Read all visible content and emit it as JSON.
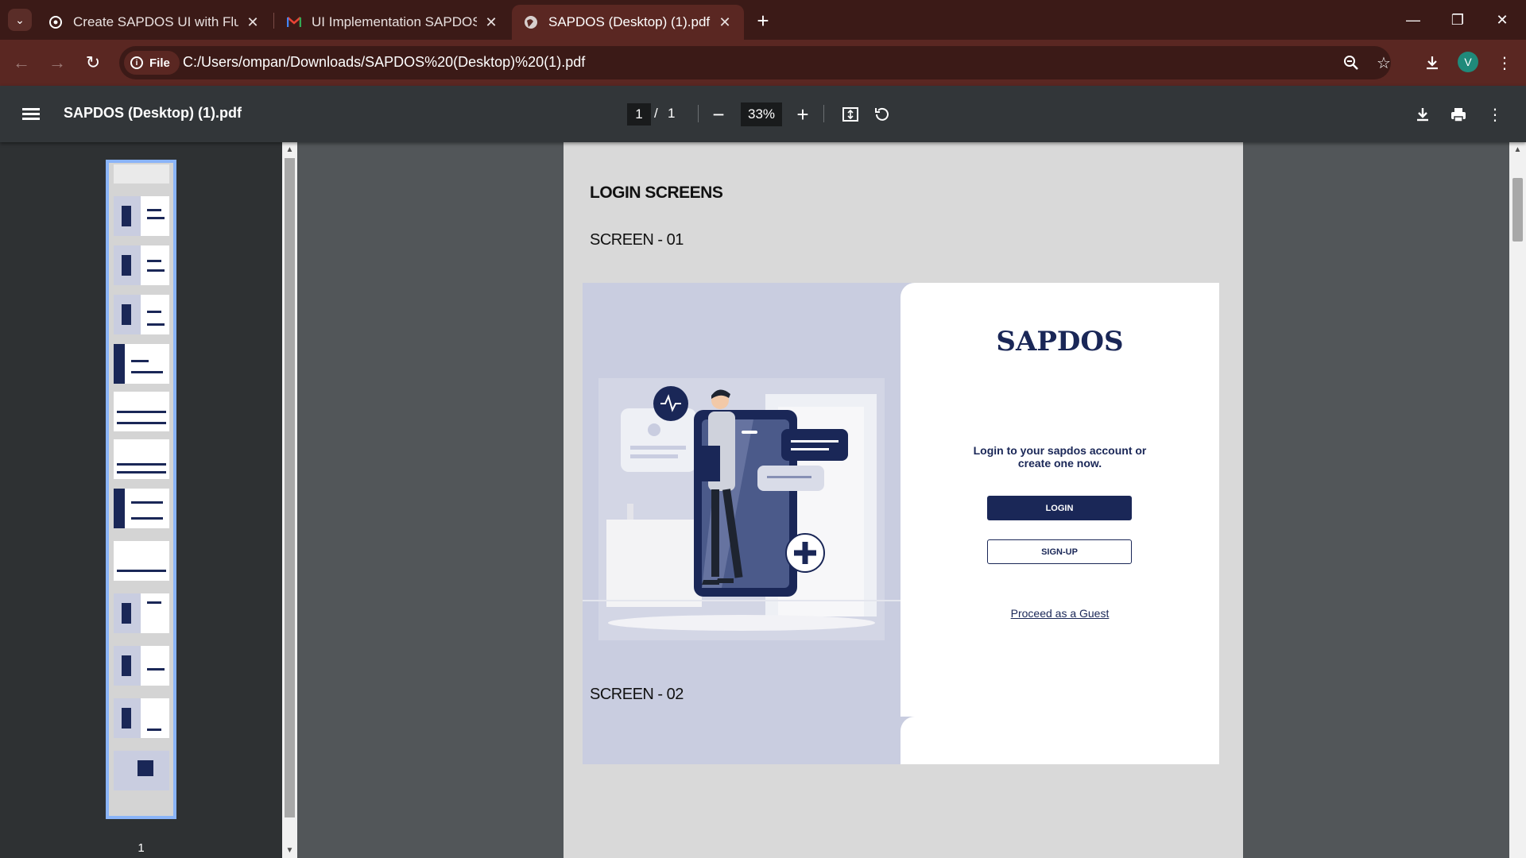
{
  "browser": {
    "tabs": [
      {
        "title": "Create SAPDOS UI with Flutter",
        "icon": "chatgpt-icon"
      },
      {
        "title": "UI Implementation SAPDOS Pro",
        "icon": "gmail-icon"
      },
      {
        "title": "SAPDOS (Desktop) (1).pdf",
        "icon": "globe-icon",
        "active": true
      }
    ],
    "address": {
      "chip_label": "File",
      "url": "C:/Users/ompan/Downloads/SAPDOS%20(Desktop)%20(1).pdf"
    },
    "profile_initial": "V"
  },
  "pdf_viewer": {
    "title": "SAPDOS (Desktop) (1).pdf",
    "current_page": "1",
    "separator": "/",
    "total_pages": "1",
    "zoom": "33%",
    "thumbnail_label": "1"
  },
  "document": {
    "section_title": "LOGIN SCREENS",
    "screen1_title": "SCREEN - 01",
    "screen2_title": "SCREEN - 02",
    "brand": "SAPDOS",
    "tagline": "Login to your sapdos account or create one now.",
    "login_label": "LOGIN",
    "signup_label": "SIGN-UP",
    "guest_label": "Proceed as a Guest",
    "colors": {
      "navy": "#1a2757",
      "illustration_bg": "#c9cde0"
    }
  }
}
